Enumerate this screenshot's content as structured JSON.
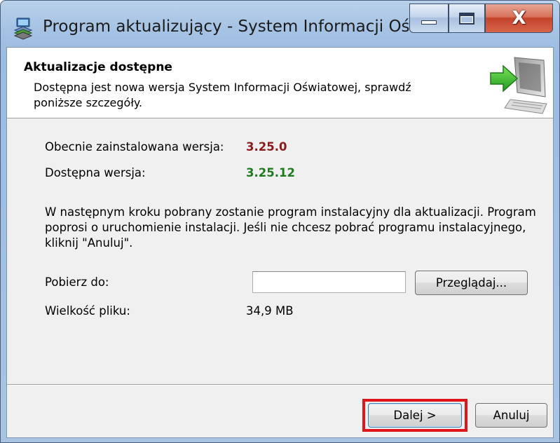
{
  "window": {
    "title": "Program aktualizujący - System Informacji Oświa...",
    "minimize_icon": "minimize-icon",
    "maximize_icon": "maximize-icon",
    "close_label": "X"
  },
  "header": {
    "title": "Aktualizacje dostępne",
    "description": "Dostępna jest nowa wersja System Informacji Oświatowej, sprawdź poniższe szczegóły.",
    "icon": "computer-update-icon"
  },
  "versions": {
    "installed_label": "Obecnie zainstalowana wersja:",
    "installed_value": "3.25.0",
    "installed_color": "#8b1a1a",
    "available_label": "Dostępna wersja:",
    "available_value": "3.25.12",
    "available_color": "#1e7a1e"
  },
  "info_text": "W następnym kroku pobrany zostanie program instalacyjny dla aktualizacji. Program poprosi o uruchomienie instalacji. Jeśli nie chcesz pobrać programu instalacyjnego, kliknij \"Anuluj\".",
  "download": {
    "label": "Pobierz do:",
    "path_value": "",
    "browse_label": "Przeglądaj..."
  },
  "file_size": {
    "label": "Wielkość pliku:",
    "value": "34,9 MB"
  },
  "footer": {
    "next_label": "Dalej >",
    "cancel_label": "Anuluj",
    "highlight_color": "#e0151b"
  }
}
